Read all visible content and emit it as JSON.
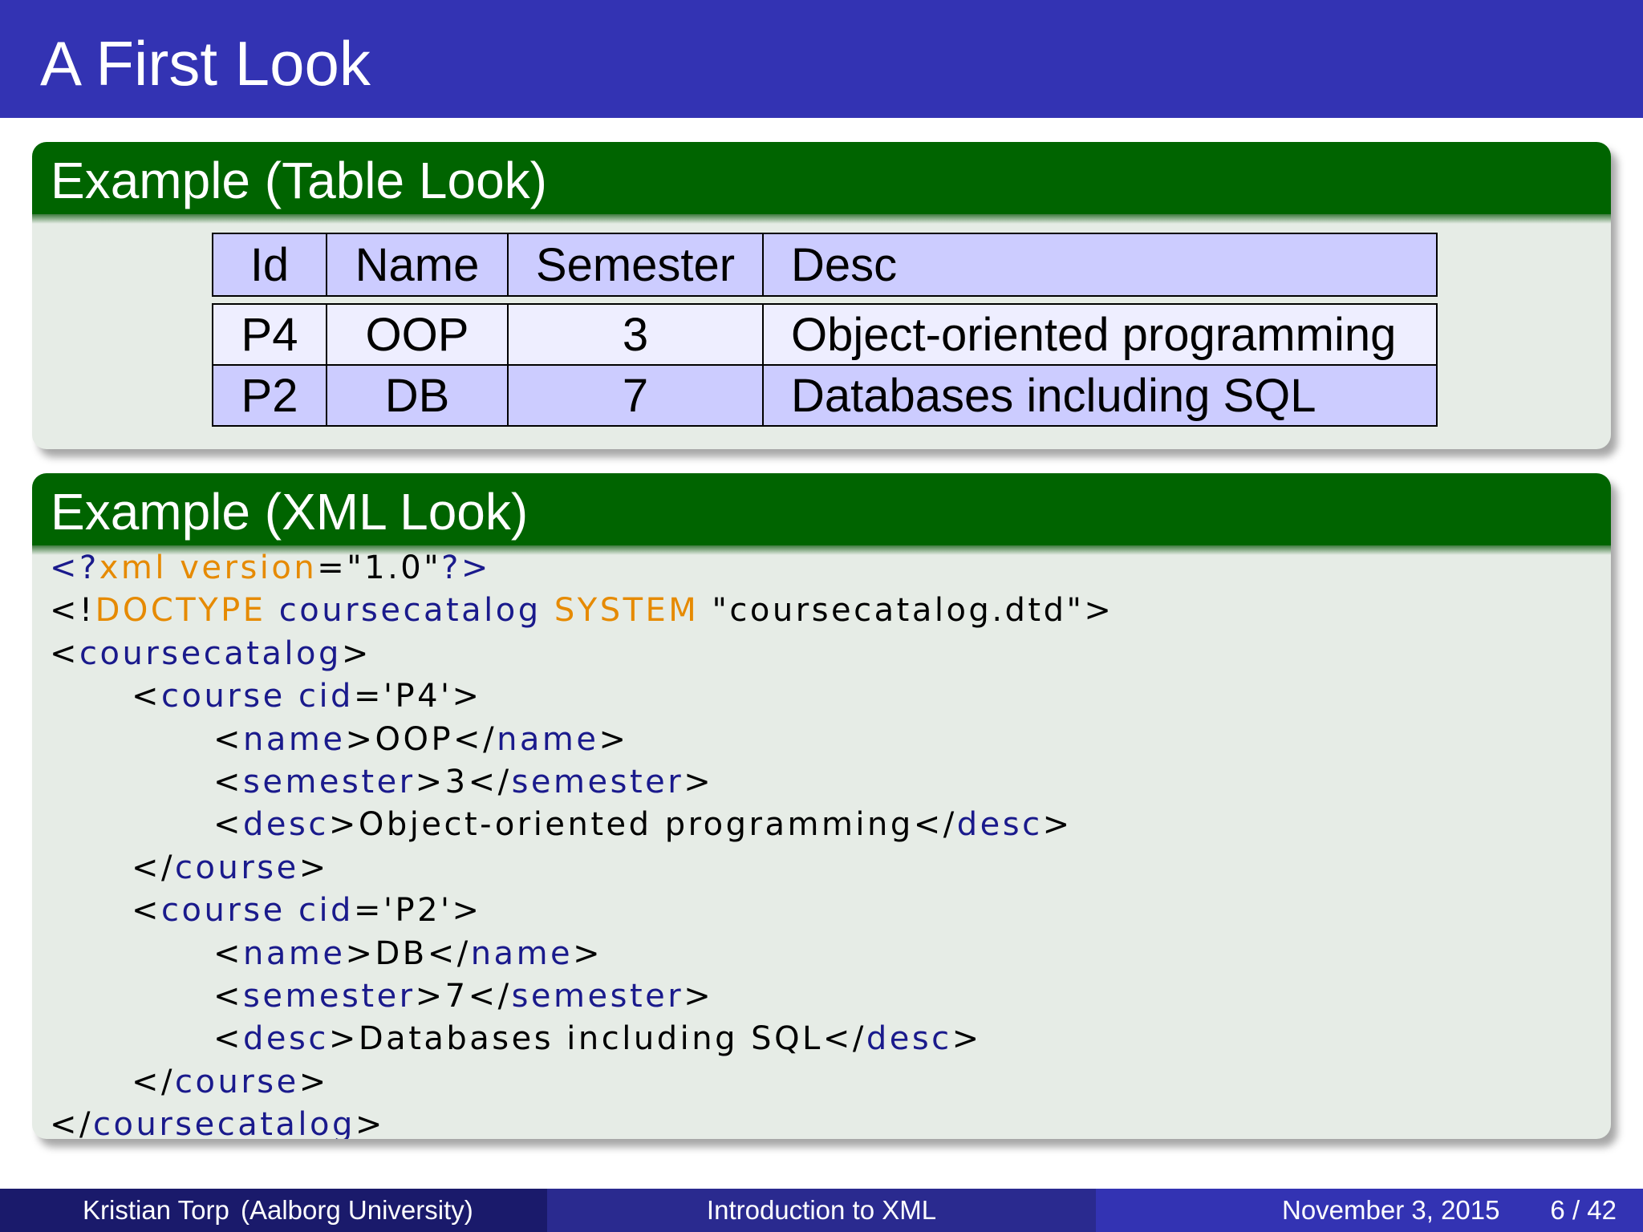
{
  "slide": {
    "title": "A First Look"
  },
  "table_block": {
    "title": "Example (Table Look)",
    "headers": [
      "Id",
      "Name",
      "Semester",
      "Desc"
    ],
    "rows": [
      [
        "P4",
        "OOP",
        "3",
        "Object-oriented programming"
      ],
      [
        "P2",
        "DB",
        "7",
        "Databases including SQL"
      ]
    ]
  },
  "xml_block": {
    "title": "Example (XML Look)",
    "lines": [
      "<?xml version=\"1.0\"?>",
      "<!DOCTYPE coursecatalog SYSTEM \"coursecatalog.dtd\">",
      "<coursecatalog>",
      "<course cid='P4'>",
      "<name>OOP</name>",
      "<semester>3</semester>",
      "<desc>Object-oriented programming</desc>",
      "</course>",
      "<course cid='P2'>",
      "<name>DB</name>",
      "<semester>7</semester>",
      "<desc>Databases including SQL</desc>",
      "</course>",
      "</coursecatalog>"
    ]
  },
  "footer": {
    "author": "Kristian Torp",
    "institution": "(Aalborg University)",
    "talk_title": "Introduction to XML",
    "date": "November 3, 2015",
    "page": "6 / 42"
  },
  "colors": {
    "title_bar": "#3333b3",
    "block_header": "#006400",
    "block_body": "#e6ece6",
    "table_header_fill": "#ccccff",
    "table_row_light": "#eeeeff",
    "xml_keyword": "#e68a00",
    "xml_tag": "#1a1a8c"
  }
}
